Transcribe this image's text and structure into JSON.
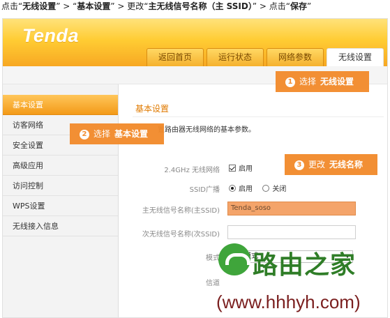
{
  "instruction": {
    "p1": "点击“",
    "b1": "无线设置",
    "p2": "” > “",
    "b2": "基本设置",
    "p3": "” > 更改“",
    "b3": "主无线信号名称（主 SSID）",
    "p4": "” > 点击“",
    "b4": "保存",
    "p5": "”"
  },
  "header": {
    "logo": "Tenda",
    "tabs": [
      "返回首页",
      "运行状态",
      "网络参数",
      "无线设置"
    ],
    "active_tab": "无线设置"
  },
  "sidebar": {
    "items": [
      "基本设置",
      "访客网络",
      "安全设置",
      "高级应用",
      "访问控制",
      "WPS设置",
      "无线接入信息"
    ],
    "active": "基本设置"
  },
  "content": {
    "title": "基本设置",
    "desc": "置路由器无线网络的基本参数。",
    "wifi_24_label": "2.4GHz 无线网络",
    "wifi_24_value": "启用",
    "ssid_broadcast_label": "SSID广播",
    "ssid_broadcast_on": "启用",
    "ssid_broadcast_off": "关闭",
    "main_ssid_label": "主无线信号名称(主SSID)",
    "main_ssid_value": "Tenda_soso",
    "sub_ssid_label": "次无线信号名称(次SSID)",
    "sub_ssid_value": "",
    "mode_label": "模式",
    "mode_value": "11b模式",
    "channel_label": "信道"
  },
  "callouts": [
    {
      "num": "1",
      "prefix": "选择",
      "bold": "无线设置"
    },
    {
      "num": "2",
      "prefix": "选择",
      "bold": "基本设置"
    },
    {
      "num": "3",
      "prefix": "更改",
      "bold": "无线名称"
    }
  ],
  "watermark": {
    "cn": "路由之家",
    "url": "(www.hhhyh.com)"
  },
  "colors": {
    "header_orange": "#f7a823",
    "callout_orange": "#f28a2a",
    "watermark_green": "#3fa53b",
    "watermark_url": "#7a1e1e"
  }
}
